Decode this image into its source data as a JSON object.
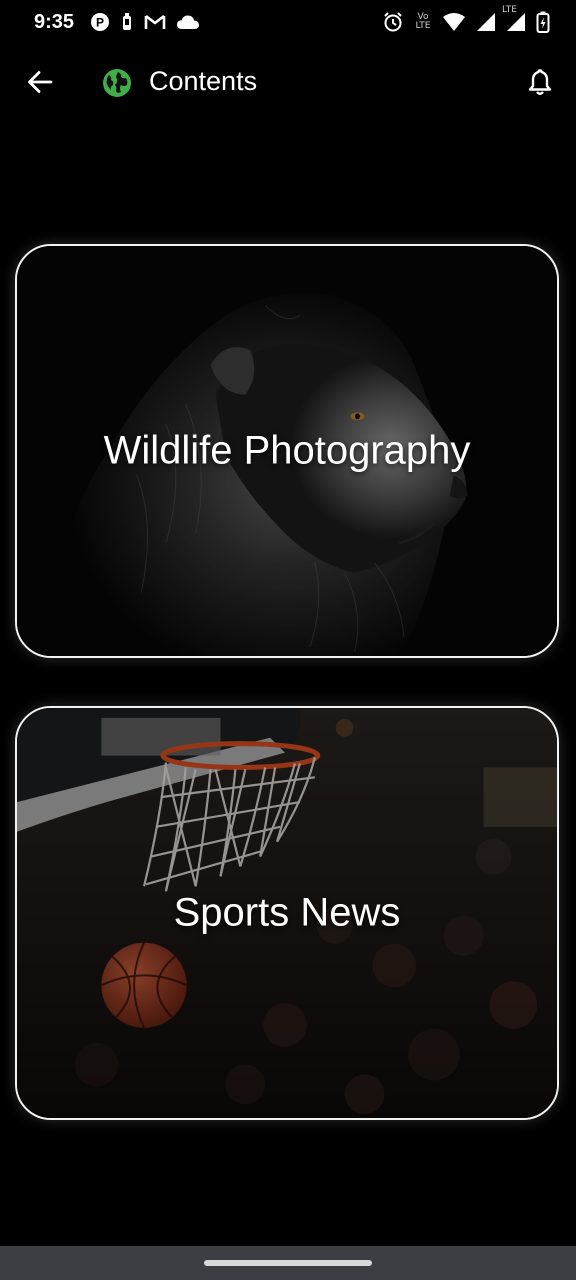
{
  "status_bar": {
    "time": "9:35",
    "left_icons": [
      "p-badge-icon",
      "battery-saver-icon",
      "gmail-icon",
      "cloud-icon"
    ],
    "right_icons": [
      "alarm-icon",
      "volte-icon",
      "wifi-icon",
      "signal-icon",
      "lte-signal-icon",
      "battery-charging-icon"
    ],
    "volte_label": "Vo LTE",
    "lte_label": "LTE"
  },
  "app_bar": {
    "title": "Contents",
    "back_icon": "arrow-left-icon",
    "logo_icon": "globe-icon",
    "notification_icon": "bell-icon",
    "logo_color": "#3fae49"
  },
  "cards": [
    {
      "title": "Wildlife Photography",
      "image": "lion-portrait"
    },
    {
      "title": "Sports News",
      "image": "basketball-hoop"
    }
  ],
  "colors": {
    "background": "#000000",
    "card_border": "#f2f2f2",
    "nav_bar": "#3b3f44"
  }
}
